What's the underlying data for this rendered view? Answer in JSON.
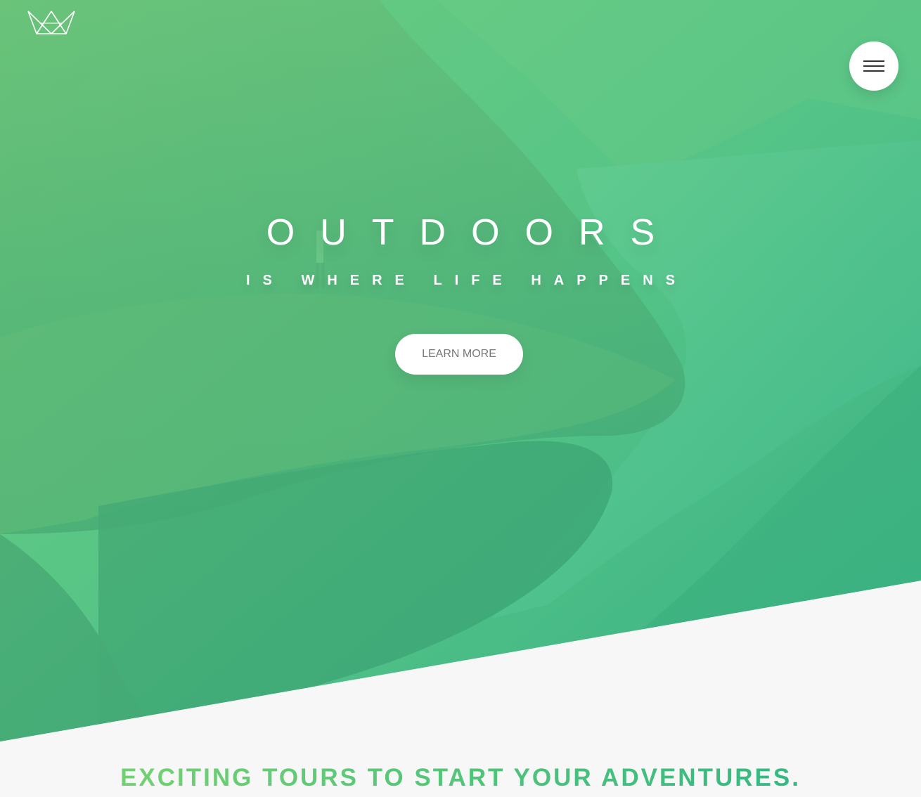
{
  "hero": {
    "title": "OUTDOORS",
    "subtitle": "IS WHERE LIFE HAPPENS",
    "cta_label": "LEARN MORE"
  },
  "header": {
    "logo_icon": "crown-outline-logo",
    "menu_icon": "hamburger-menu-icon"
  },
  "section": {
    "heading": "EXCITING TOURS TO START YOUR ADVENTURES."
  },
  "colors": {
    "primary_light": "#7ed56f",
    "primary_dark": "#28b485",
    "background": "#f7f7f7",
    "white": "#ffffff",
    "button_text": "#777777"
  }
}
